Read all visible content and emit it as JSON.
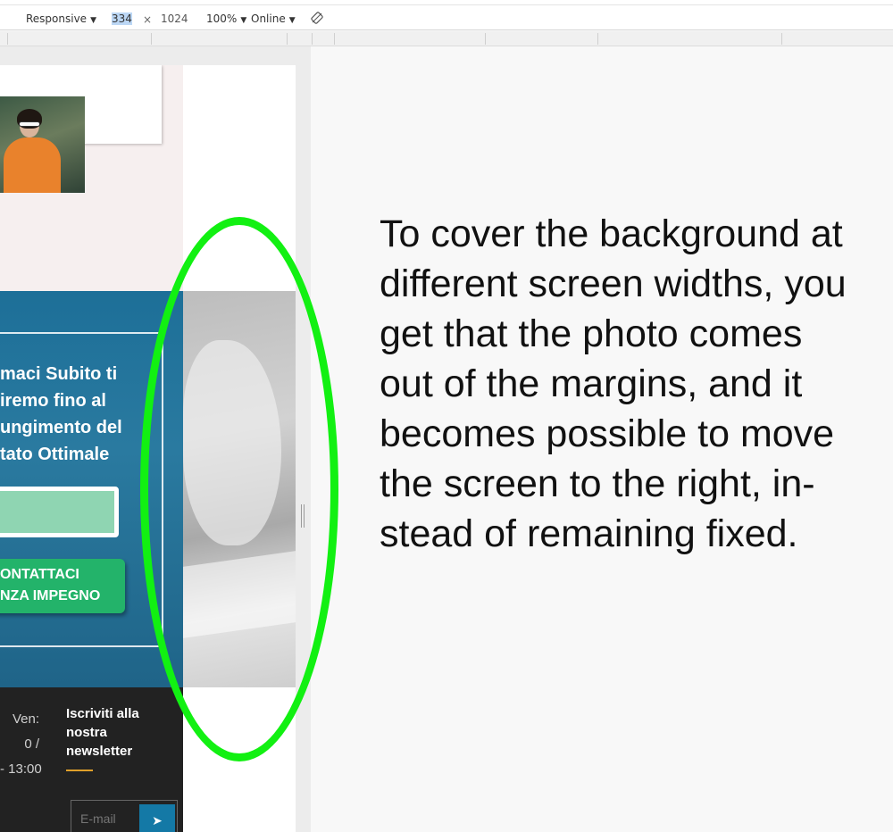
{
  "toolbar": {
    "device_label": "Responsive",
    "width_value": "334",
    "times_symbol": "×",
    "height_value": "1024",
    "zoom_label": "100%",
    "throttle_label": "Online",
    "caret": "▼"
  },
  "page": {
    "cta": {
      "title_lines": [
        "maci Subito ti",
        "iremo fino al",
        "ungimento del",
        "tato Ottimale"
      ],
      "button_lines": [
        "ONTATTACI",
        "NZA IMPEGNO"
      ]
    },
    "footer": {
      "hours_lines": [
        "Ven:",
        "0 /",
        "- 13:00"
      ],
      "newsletter_lines": [
        "Iscriviti alla",
        "nostra",
        "newsletter"
      ],
      "email_placeholder": "E-mail",
      "send_icon_glyph": "➤"
    }
  },
  "annotation": {
    "lines": [
      "To cover the background at",
      "different screen widths, you",
      "get that the photo comes",
      "out of the margins, and it",
      "becomes possible to move",
      "the screen to the right, in-",
      "stead of remaining fixed."
    ]
  },
  "colors": {
    "highlight": "#12f012",
    "cta_blue": "#1d6f98",
    "cta_green": "#23b36a",
    "footer_dark": "#222222",
    "accent_orange": "#e0a02a"
  }
}
